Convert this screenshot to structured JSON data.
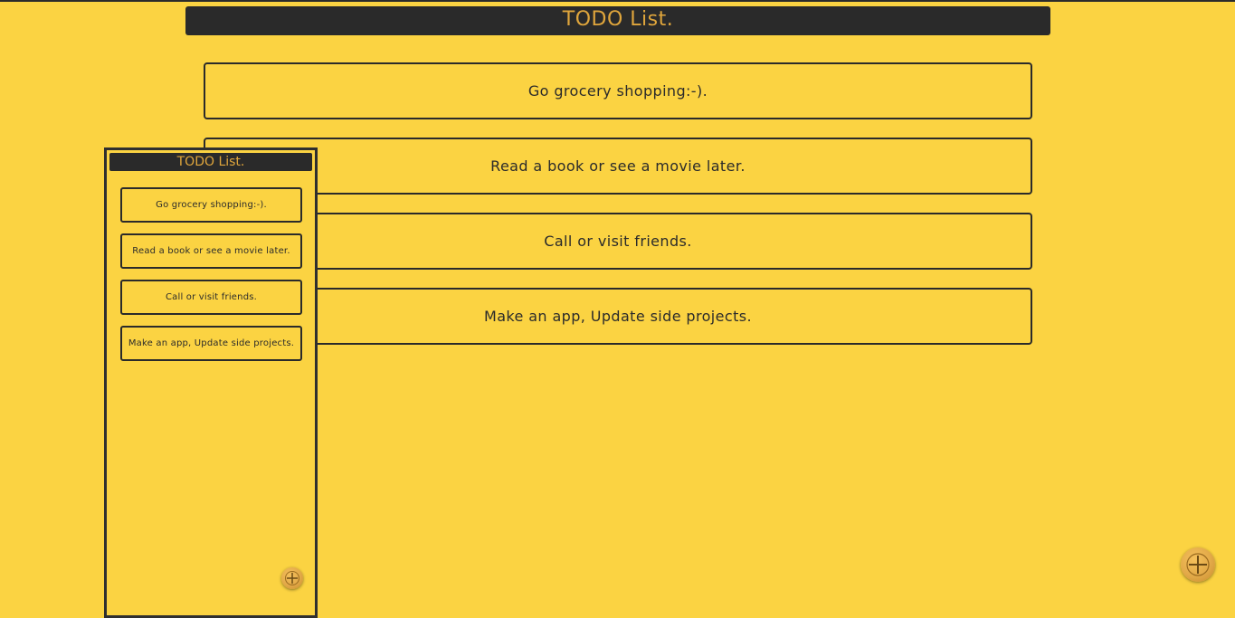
{
  "app": {
    "title": "TODO List."
  },
  "todos": [
    {
      "text": "Go grocery shopping:-)."
    },
    {
      "text": "Read a book or see a movie later."
    },
    {
      "text": "Call or visit friends."
    },
    {
      "text": "Make an app, Update side projects."
    }
  ],
  "preview": {
    "title": "TODO List.",
    "todos": [
      {
        "text": "Go grocery shopping:-)."
      },
      {
        "text": "Read a book or see a movie later."
      },
      {
        "text": "Call or visit friends."
      },
      {
        "text": "Make an app, Update side projects."
      }
    ]
  },
  "icons": {
    "add_button": "plus-icon"
  },
  "colors": {
    "background": "#fbd342",
    "header_bg": "#2a2a2a",
    "header_text": "#e0a63c",
    "card_border": "#2a2a2a",
    "add_button": "#e2a948"
  }
}
